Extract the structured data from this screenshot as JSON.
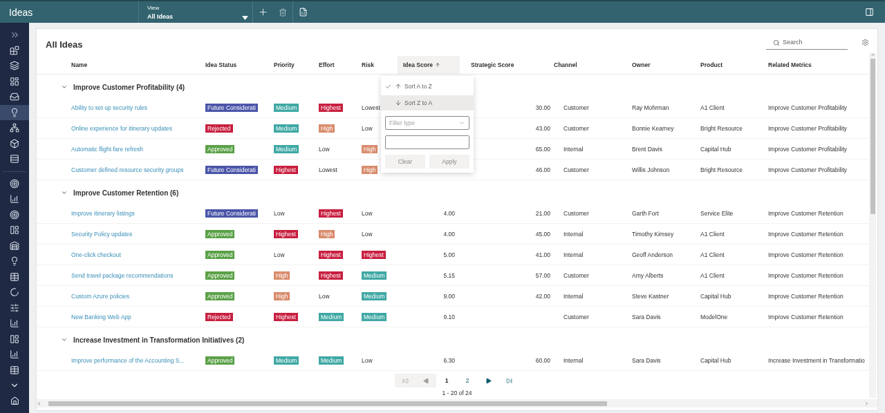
{
  "app_bar": {
    "title": "Ideas",
    "view_label": "View",
    "view_value": "All Ideas"
  },
  "sidebar": {
    "items": [
      {
        "selected": false
      },
      {
        "selected": false
      },
      {
        "selected": false
      },
      {
        "selected": false
      },
      {
        "selected": true
      },
      {
        "selected": false
      },
      {
        "selected": false
      },
      {
        "selected": false
      },
      {
        "selected": false
      },
      {
        "selected": false
      },
      {
        "selected": false
      },
      {
        "selected": false
      },
      {
        "selected": false
      },
      {
        "selected": false
      },
      {
        "selected": false
      },
      {
        "selected": false
      },
      {
        "selected": false
      },
      {
        "selected": false
      },
      {
        "selected": false
      },
      {
        "selected": false
      },
      {
        "selected": false
      }
    ]
  },
  "page_title": "All Ideas",
  "search": {
    "placeholder": "Search"
  },
  "columns": [
    {
      "label": "Name",
      "sorted": false
    },
    {
      "label": "Idea Status",
      "sorted": false
    },
    {
      "label": "Priority",
      "sorted": false
    },
    {
      "label": "Effort",
      "sorted": false
    },
    {
      "label": "Risk",
      "sorted": false
    },
    {
      "label": "Idea Score",
      "sorted": true
    },
    {
      "label": "Strategic Score",
      "sorted": false
    },
    {
      "label": "Channel",
      "sorted": false
    },
    {
      "label": "Owner",
      "sorted": false
    },
    {
      "label": "Product",
      "sorted": false
    },
    {
      "label": "Related Metrics",
      "sorted": false
    }
  ],
  "groups": [
    {
      "title": "Improve Customer Profitability (4)",
      "expanded": true,
      "rows": [
        {
          "name": "Ability to set up security rules",
          "status": {
            "text": "Future Considerati",
            "color": "#4a55a8"
          },
          "priority": {
            "text": "Medium",
            "color": "#3fa8a4"
          },
          "effort": {
            "text": "Highest",
            "color": "#c81f3f"
          },
          "risk": {
            "text": "Lowest"
          },
          "strategic_score": "30.00",
          "channel": "Customer",
          "owner": "Ray Mohrman",
          "product": "A1 Client",
          "related_metrics": "Improve Customer Profitability"
        },
        {
          "name": "Online experience for itinerary updates",
          "status": {
            "text": "Rejected",
            "color": "#c81f3f"
          },
          "priority": {
            "text": "Medium",
            "color": "#3fa8a4"
          },
          "effort": {
            "text": "High",
            "color": "#d98b6b"
          },
          "risk": {
            "text": "Low"
          },
          "strategic_score": "43.00",
          "channel": "Customer",
          "owner": "Bonnie Kearney",
          "product": "Bright Resource",
          "related_metrics": "Improve Customer Profitability"
        },
        {
          "name": "Automatic flight fare refresh",
          "status": {
            "text": "Approved",
            "color": "#5aa147"
          },
          "priority": {
            "text": "Medium",
            "color": "#3fa8a4"
          },
          "effort": {
            "text": "Low"
          },
          "risk": {
            "text": "High",
            "color": "#d98b6b"
          },
          "strategic_score": "65.00",
          "channel": "Internal",
          "owner": "Brent Davis",
          "product": "Capital Hub",
          "related_metrics": "Improve Customer Profitability"
        },
        {
          "name": "Customer defined resource security groups",
          "status": {
            "text": "Future Considerati",
            "color": "#4a55a8"
          },
          "priority": {
            "text": "Highest",
            "color": "#c81f3f"
          },
          "effort": {
            "text": "Lowest"
          },
          "risk": {
            "text": "High",
            "color": "#d98b6b"
          },
          "strategic_score": "46.00",
          "channel": "Customer",
          "owner": "Willis Johnson",
          "product": "Bright Resource",
          "related_metrics": "Improve Customer Profitability"
        }
      ]
    },
    {
      "title": "Improve Customer Retention (6)",
      "expanded": true,
      "rows": [
        {
          "name": "Improve itinerary listings",
          "status": {
            "text": "Future Considerati",
            "color": "#4a55a8"
          },
          "priority": {
            "text": "Low"
          },
          "effort": {
            "text": "Highest",
            "color": "#c81f3f"
          },
          "risk": {
            "text": "Low"
          },
          "idea_score": "4.00",
          "strategic_score": "21.00",
          "channel": "Customer",
          "owner": "Garth Fort",
          "product": "Service Elite",
          "related_metrics": "Improve Customer Retention"
        },
        {
          "name": "Security Policy updates",
          "status": {
            "text": "Approved",
            "color": "#5aa147"
          },
          "priority": {
            "text": "Highest",
            "color": "#c81f3f"
          },
          "effort": {
            "text": "High",
            "color": "#d98b6b"
          },
          "risk": {
            "text": "Low"
          },
          "idea_score": "4.00",
          "strategic_score": "45.00",
          "channel": "Internal",
          "owner": "Timothy Kimsey",
          "product": "A1 Client",
          "related_metrics": "Improve Customer Retention"
        },
        {
          "name": "One-click checkout",
          "status": {
            "text": "Approved",
            "color": "#5aa147"
          },
          "priority": {
            "text": "Low"
          },
          "effort": {
            "text": "Highest",
            "color": "#c81f3f"
          },
          "risk": {
            "text": "Highest",
            "color": "#c81f3f"
          },
          "idea_score": "5.00",
          "strategic_score": "41.00",
          "channel": "Internal",
          "owner": "Geoff Anderson",
          "product": "A1 Client",
          "related_metrics": "Improve Customer Retention"
        },
        {
          "name": "Send travel package recommendations",
          "status": {
            "text": "Approved",
            "color": "#5aa147"
          },
          "priority": {
            "text": "High",
            "color": "#d98b6b"
          },
          "effort": {
            "text": "Highest",
            "color": "#c81f3f"
          },
          "risk": {
            "text": "Medium",
            "color": "#3fa8a4"
          },
          "idea_score": "5.15",
          "strategic_score": "57.00",
          "channel": "Customer",
          "owner": "Amy Alberts",
          "product": "A1 Client",
          "related_metrics": "Improve Customer Retention"
        },
        {
          "name": "Custom Azure policies",
          "status": {
            "text": "Approved",
            "color": "#5aa147"
          },
          "priority": {
            "text": "High",
            "color": "#d98b6b"
          },
          "effort": {
            "text": "Low"
          },
          "risk": {
            "text": "Medium",
            "color": "#3fa8a4"
          },
          "idea_score": "9.00",
          "strategic_score": "42.00",
          "channel": "Internal",
          "owner": "Steve Kastner",
          "product": "Capital Hub",
          "related_metrics": "Improve Customer Retention"
        },
        {
          "name": "New Banking Web App",
          "status": {
            "text": "Rejected",
            "color": "#c81f3f"
          },
          "priority": {
            "text": "Highest",
            "color": "#c81f3f"
          },
          "effort": {
            "text": "Medium",
            "color": "#3fa8a4"
          },
          "risk": {
            "text": "Medium",
            "color": "#3fa8a4"
          },
          "idea_score": "9.10",
          "channel": "Customer",
          "owner": "Sara Davis",
          "product": "ModelOne",
          "related_metrics": "Improve Customer Retention"
        }
      ]
    },
    {
      "title": "Increase Investment in Transformation Initiatives (2)",
      "expanded": true,
      "rows": [
        {
          "name": "Improve performance of the Accounting S...",
          "status": {
            "text": "Approved",
            "color": "#5aa147"
          },
          "priority": {
            "text": "Medium",
            "color": "#3fa8a4"
          },
          "effort": {
            "text": "Medium",
            "color": "#3fa8a4"
          },
          "risk": {
            "text": "Low"
          },
          "idea_score": "6.30",
          "strategic_score": "60.00",
          "channel": "Internal",
          "owner": "Sara Davis",
          "product": "Capital Hub",
          "related_metrics": "Increase Investment in Transformatio"
        }
      ]
    }
  ],
  "sort_menu": {
    "items": [
      {
        "label": "Sort A to Z",
        "checked": true,
        "hovered": false,
        "kind": "up"
      },
      {
        "label": "Sort Z to A",
        "checked": false,
        "hovered": true,
        "kind": "down"
      }
    ],
    "filter_select": {
      "placeholder": "Filter type"
    },
    "buttons": [
      {
        "label": "Clear",
        "disabled": true
      },
      {
        "label": "Apply",
        "disabled": true
      }
    ]
  },
  "pagination": {
    "pages": [
      {
        "label": "1",
        "selected": true
      },
      {
        "label": "2",
        "selected": false
      }
    ],
    "summary": "1 - 20 of 24"
  }
}
